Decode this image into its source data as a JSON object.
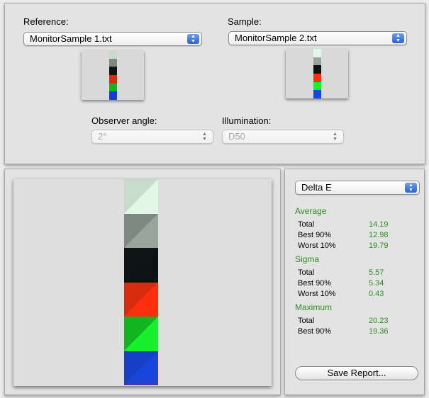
{
  "reference": {
    "label": "Reference:",
    "selected": "MonitorSample 1.txt"
  },
  "sample": {
    "label": "Sample:",
    "selected": "MonitorSample 2.txt"
  },
  "observer": {
    "label": "Observer angle:",
    "selected": "2°"
  },
  "illumination": {
    "label": "Illumination:",
    "selected": "D50"
  },
  "colors": {
    "ref_strip": [
      "#c9dccb",
      "#7c8a82",
      "#101416",
      "#d92b10",
      "#10b520",
      "#1640c8"
    ],
    "sample_strip": [
      "#e2f7e6",
      "#99a49d",
      "#0d1214",
      "#ff2e0c",
      "#18f02c",
      "#1845dc"
    ],
    "accent": "#2e8b22"
  },
  "metric": {
    "selected": "Delta E"
  },
  "stats": {
    "average": {
      "heading": "Average",
      "rows": [
        {
          "label": "Total",
          "value": "14.19"
        },
        {
          "label": "Best 90%",
          "value": "12.98"
        },
        {
          "label": "Worst 10%",
          "value": "19.79"
        }
      ]
    },
    "sigma": {
      "heading": "Sigma",
      "rows": [
        {
          "label": "Total",
          "value": "5.57"
        },
        {
          "label": "Best 90%",
          "value": "5.34"
        },
        {
          "label": "Worst 10%",
          "value": "0.43"
        }
      ]
    },
    "maximum": {
      "heading": "Maximum",
      "rows": [
        {
          "label": "Total",
          "value": "20.23"
        },
        {
          "label": "Best 90%",
          "value": "19.36"
        }
      ]
    }
  },
  "save_label": "Save Report..."
}
